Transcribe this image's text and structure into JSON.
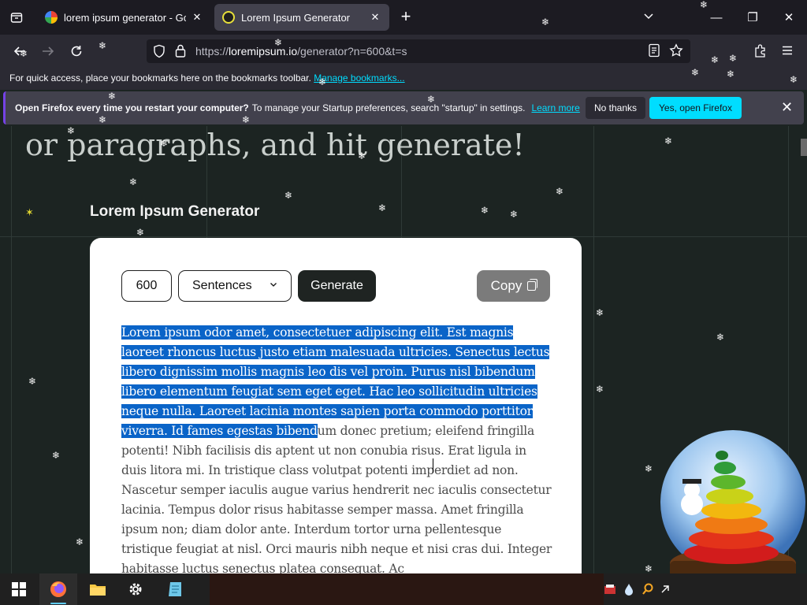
{
  "browser": {
    "tabs": [
      {
        "title": "lorem ipsum generator - Google",
        "favicon": "google-icon"
      },
      {
        "title": "Lorem Ipsum Generator",
        "favicon": "site-icon"
      }
    ],
    "new_tab_label": "+",
    "url_prefix": "https://",
    "url_host": "loremipsum.io",
    "url_path": "/generator?n=600&t=s"
  },
  "bookmarks_bar": {
    "text": "For quick access, place your bookmarks here on the bookmarks toolbar.",
    "link": "Manage bookmarks..."
  },
  "notification": {
    "bold": "Open Firefox every time you restart your computer?",
    "text": "To manage your Startup preferences, search \"startup\" in settings.",
    "learn_more": "Learn more",
    "no_thanks": "No thanks",
    "yes_open": "Yes, open Firefox"
  },
  "page": {
    "hero_text": "or paragraphs, and hit generate!",
    "section_title": "Lorem Ipsum Generator",
    "generator": {
      "count": "600",
      "unit": "Sentences",
      "generate_label": "Generate",
      "copy_label": "Copy"
    },
    "output_selected": "Lorem ipsum odor amet, consectetuer adipiscing elit. Est magnis laoreet rhoncus luctus justo etiam malesuada ultricies. Senectus lectus libero dignissim mollis magnis leo dis vel proin. Purus nisl bibendum libero elementum feugiat sem eget eget. Hac leo sollicitudin ultricies neque nulla. Laoreet lacinia montes sapien porta commodo porttitor viverra. Id fames egestas bibend",
    "output_rest": "um donec pretium; eleifend fringilla potenti! Nibh facilisis dis aptent ut non conubia risus. Erat ligula in duis litora mi. In tristique class volutpat potenti imperdiet ad non. Nascetur semper iaculis augue varius hendrerit nec iaculis consectetur lacinia. Tempus dolor risus habitasse semper massa. Amet fringilla ipsum non; diam dolor ante. Interdum tortor urna pellentesque tristique feugiat at nisl. Orci mauris nibh neque et nisi cras dui. Integer habitasse luctus senectus platea consequat. Ac"
  },
  "colors": {
    "selection": "#0a64c8",
    "accent_cyan": "#00ddff",
    "generate_button": "#1f2422",
    "copy_button": "#7b7b7b"
  }
}
